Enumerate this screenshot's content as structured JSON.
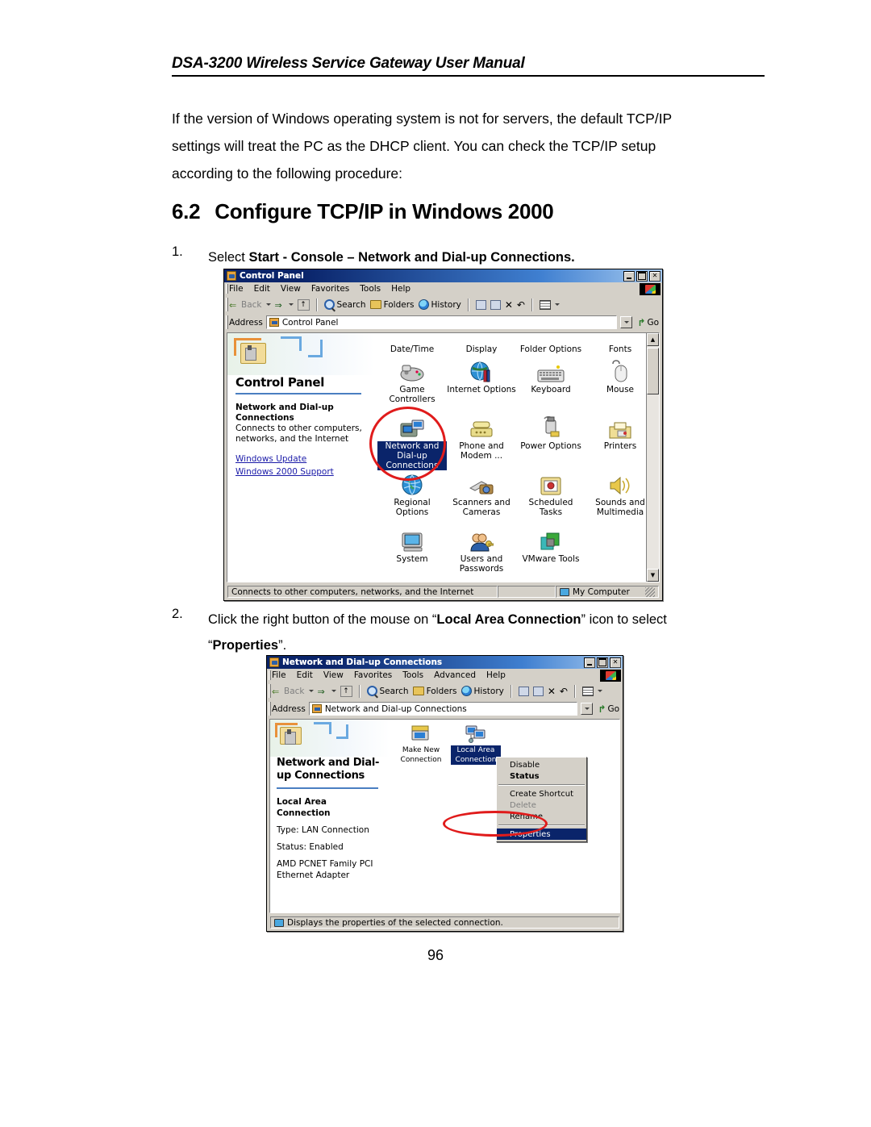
{
  "header": {
    "title": "DSA-3200 Wireless Service Gateway User Manual"
  },
  "intro": {
    "line1": "If the version of Windows operating system is not for servers, the default TCP/IP",
    "line2": "settings will treat the PC as the DHCP client.   You can check the TCP/IP setup",
    "line3": "according to the following procedure:"
  },
  "section": {
    "number": "6.2",
    "title": "Configure TCP/IP in Windows 2000"
  },
  "steps": {
    "step1": {
      "number": "1.",
      "prefix": "Select ",
      "bold": "Start - Console – Network and Dial-up Connections."
    },
    "step2": {
      "number": "2.",
      "line1_a": "Click the right button of the mouse on “",
      "line1_b": "Local Area Connection",
      "line1_c": "” icon to select",
      "line2_a": "“",
      "line2_b": "Properties",
      "line2_c": "”."
    }
  },
  "page_number": "96",
  "window1": {
    "title": "Control Panel",
    "title_icon": "control-panel-icon",
    "buttons": {
      "minimize": "_",
      "maximize": "□",
      "close": "✕"
    },
    "menu": [
      "File",
      "Edit",
      "View",
      "Favorites",
      "Tools",
      "Help"
    ],
    "toolbar": {
      "back": "Back",
      "forward": "",
      "up": "",
      "search": "Search",
      "folders": "Folders",
      "history": "History",
      "views": ""
    },
    "address": {
      "label": "Address",
      "value": "Control Panel",
      "go": "Go"
    },
    "left_pane": {
      "title": "Control Panel",
      "item_title": "Network and Dial-up Connections",
      "item_desc": "Connects to other computers, networks, and the Internet",
      "links": [
        "Windows Update",
        "Windows 2000 Support"
      ]
    },
    "icons": [
      {
        "label": "Date/Time",
        "glyph": "clock-icon",
        "selected": false
      },
      {
        "label": "Display",
        "glyph": "display-icon",
        "selected": false
      },
      {
        "label": "Folder Options",
        "glyph": "folder-options-icon",
        "selected": false
      },
      {
        "label": "Fonts",
        "glyph": "fonts-icon",
        "selected": false
      },
      {
        "label": "Game Controllers",
        "glyph": "gamepad-icon",
        "selected": false
      },
      {
        "label": "Internet Options",
        "glyph": "internet-options-icon",
        "selected": false
      },
      {
        "label": "Keyboard",
        "glyph": "keyboard-icon",
        "selected": false
      },
      {
        "label": "Mouse",
        "glyph": "mouse-icon",
        "selected": false
      },
      {
        "label": "Network and Dial-up Connections",
        "glyph": "network-connections-icon",
        "selected": true
      },
      {
        "label": "Phone and Modem ...",
        "glyph": "phone-modem-icon",
        "selected": false
      },
      {
        "label": "Power Options",
        "glyph": "power-options-icon",
        "selected": false
      },
      {
        "label": "Printers",
        "glyph": "printers-icon",
        "selected": false
      },
      {
        "label": "Regional Options",
        "glyph": "globe-icon",
        "selected": false
      },
      {
        "label": "Scanners and Cameras",
        "glyph": "scanner-icon",
        "selected": false
      },
      {
        "label": "Scheduled Tasks",
        "glyph": "scheduled-tasks-icon",
        "selected": false
      },
      {
        "label": "Sounds and Multimedia",
        "glyph": "speaker-icon",
        "selected": false
      },
      {
        "label": "System",
        "glyph": "system-icon",
        "selected": false
      },
      {
        "label": "Users and Passwords",
        "glyph": "users-icon",
        "selected": false
      },
      {
        "label": "VMware Tools",
        "glyph": "vmware-icon",
        "selected": false
      }
    ],
    "status": {
      "left": "Connects to other computers, networks, and the Internet",
      "middle": "",
      "right": "My Computer"
    }
  },
  "window2": {
    "title": "Network and Dial-up Connections",
    "title_icon": "network-connections-icon",
    "buttons": {
      "minimize": "_",
      "restore": "□",
      "close": "✕"
    },
    "menu": [
      "File",
      "Edit",
      "View",
      "Favorites",
      "Tools",
      "Advanced",
      "Help"
    ],
    "toolbar": {
      "back": "Back",
      "search": "Search",
      "folders": "Folders",
      "history": "History"
    },
    "address": {
      "label": "Address",
      "value": "Network and Dial-up Connections",
      "go": "Go"
    },
    "left_pane": {
      "title": "Network and Dial-up Connections",
      "item_title": "Local Area Connection",
      "type": "Type: LAN Connection",
      "status": "Status: Enabled",
      "adapter": "AMD PCNET Family PCI Ethernet Adapter"
    },
    "icons": [
      {
        "label": "Make New Connection",
        "glyph": "make-new-connection-icon",
        "selected": false
      },
      {
        "label": "Local Area Connection",
        "glyph": "local-area-connection-icon",
        "selected": true
      }
    ],
    "context_menu": [
      {
        "label": "Disable",
        "style": "normal"
      },
      {
        "label": "Status",
        "style": "bold"
      },
      {
        "label": "---",
        "style": "divider"
      },
      {
        "label": "Create Shortcut",
        "style": "normal"
      },
      {
        "label": "Delete",
        "style": "disabled"
      },
      {
        "label": "Rename",
        "style": "normal"
      },
      {
        "label": "---",
        "style": "divider"
      },
      {
        "label": "Properties",
        "style": "selected"
      }
    ],
    "status": {
      "left": "Displays the properties of the selected connection."
    }
  },
  "colors": {
    "title_dark": "#0a246a",
    "title_light": "#a6caf0",
    "window_face": "#d4d0c8",
    "highlight_ring": "#e01b1b",
    "selection": "#0a246a",
    "link": "#1a1aa8"
  }
}
